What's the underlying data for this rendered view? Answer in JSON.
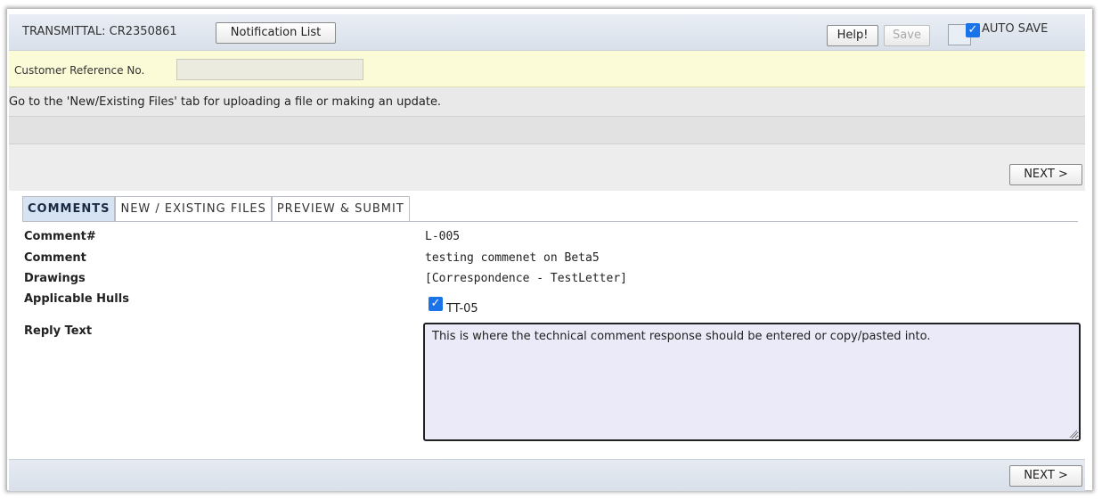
{
  "header": {
    "transmittal_label": "TRANSMITTAL: CR2350861",
    "notification_button": "Notification List",
    "help_button": "Help!",
    "save_button": "Save",
    "auto_save_label": "AUTO SAVE",
    "auto_save_checked": true
  },
  "customer": {
    "label": "Customer Reference No.",
    "value": ""
  },
  "info": {
    "message": "Go to the 'New/Existing Files' tab for uploading a file or making an update."
  },
  "navigation": {
    "next_label": "NEXT >"
  },
  "tabs": [
    {
      "label": "COMMENTS",
      "active": true
    },
    {
      "label": "NEW / EXISTING FILES",
      "active": false
    },
    {
      "label": "PREVIEW & SUBMIT",
      "active": false
    }
  ],
  "details": {
    "comment_num_label": "Comment#",
    "comment_num_value": "L-005",
    "comment_label": "Comment",
    "comment_value": "testing commenet on Beta5",
    "drawings_label": "Drawings",
    "drawings_value": "[Correspondence - TestLetter]",
    "hulls_label": "Applicable Hulls",
    "hull_value": "TT-05",
    "hull_checked": true,
    "reply_label": "Reply Text",
    "reply_value": "This is where the technical comment response should be entered or copy/pasted into."
  },
  "colors": {
    "accent": "#1a73e8",
    "customer_row_bg": "#fcfbd8",
    "active_tab_bg": "#d6e3f3",
    "reply_bg": "#eaeaf8"
  },
  "icons": {
    "checkbox": "checkbox-checked-icon",
    "resize": "resize-grip-icon"
  }
}
